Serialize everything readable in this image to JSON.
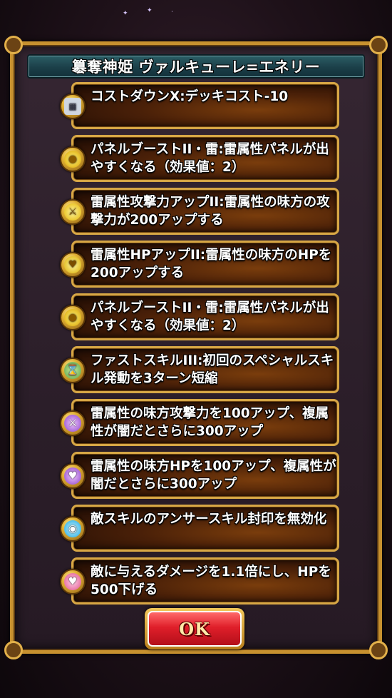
{
  "dialog": {
    "title": "簒奪神姫 ヴァルキューレ=エネリー",
    "ok_label": "OK"
  },
  "abilities": [
    {
      "icon": "deck-cost-icon",
      "text": "コストダウンX:デッキコスト-10"
    },
    {
      "icon": "panel-boost-icon",
      "text": "パネルブーストII・雷:雷属性パネルが出やすくなる（効果値：2）"
    },
    {
      "icon": "attack-up-icon",
      "text": "雷属性攻撃力アップII:雷属性の味方の攻撃力が200アップする"
    },
    {
      "icon": "hp-up-icon",
      "text": "雷属性HPアップII:雷属性の味方のHPを200アップする"
    },
    {
      "icon": "panel-boost-icon",
      "text": "パネルブーストII・雷:雷属性パネルが出やすくなる（効果値：2）"
    },
    {
      "icon": "fast-skill-icon",
      "text": "ファストスキルIII:初回のスペシャルスキル発動を3ターン短縮"
    },
    {
      "icon": "dual-attack-icon",
      "text": "雷属性の味方攻撃力を100アップ、複属性が闇だとさらに300アップ"
    },
    {
      "icon": "dual-hp-icon",
      "text": "雷属性の味方HPを100アップ、複属性が闇だとさらに300アップ"
    },
    {
      "icon": "answer-seal-icon",
      "text": "敵スキルのアンサースキル封印を無効化"
    },
    {
      "icon": "damage-up-icon",
      "text": "敵に与えるダメージを1.1倍にし、HPを500下げる"
    }
  ],
  "colors": {
    "frame_gold": "#c7912f",
    "title_teal": "#1b3f48",
    "ok_red": "#e01f2a"
  }
}
